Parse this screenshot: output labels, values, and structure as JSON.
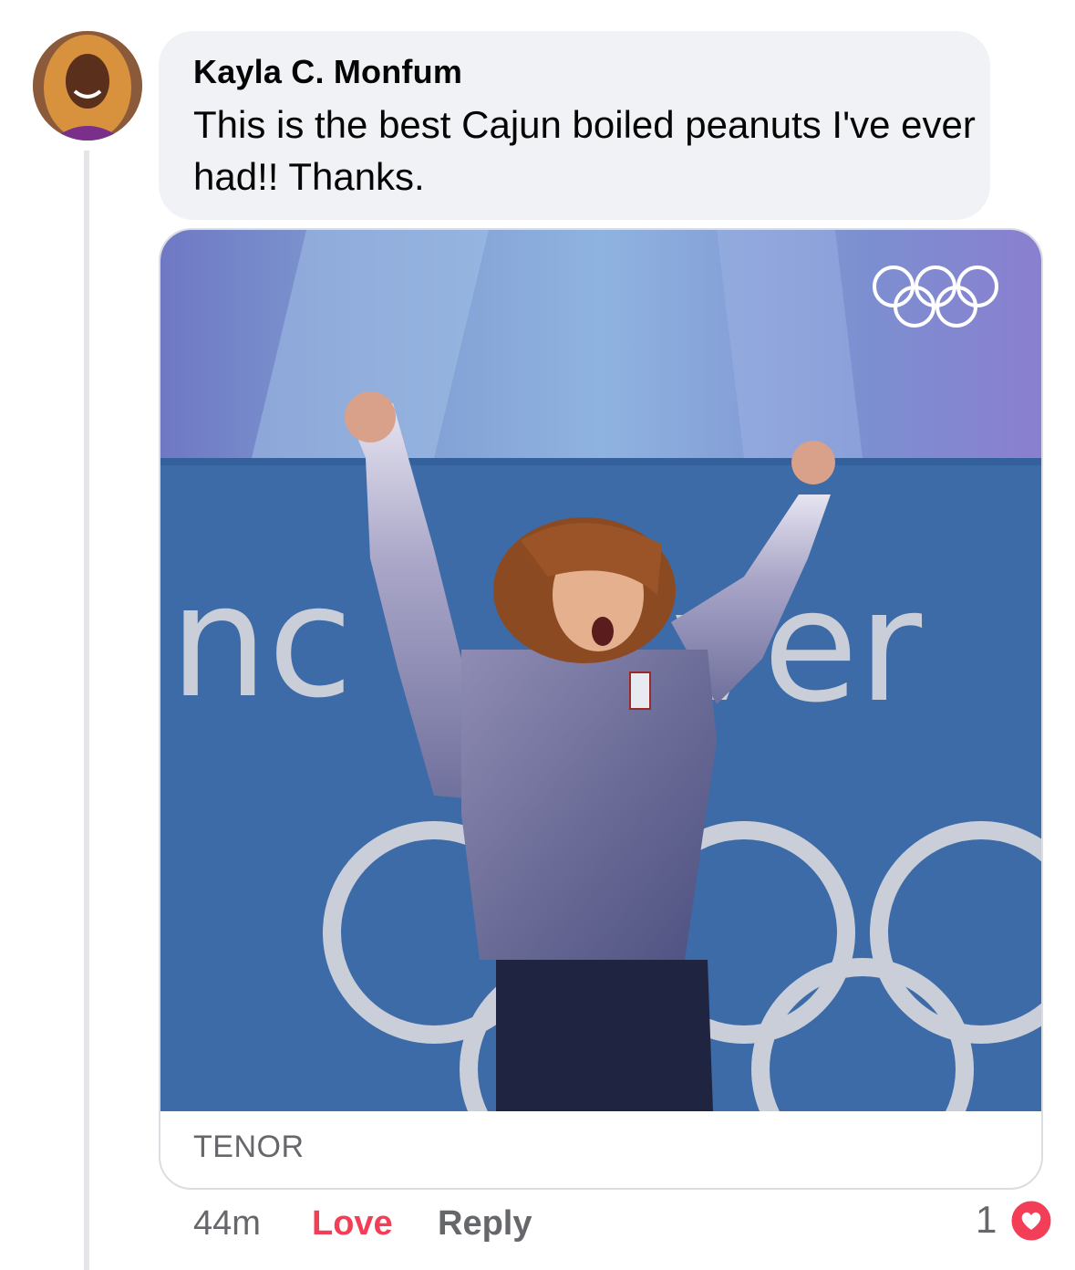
{
  "comment": {
    "author": "Kayla C. Monfum",
    "text": "This is the best Cajun boiled peanuts I've ever had!! Thanks.",
    "avatar_icon": "avatar-photo"
  },
  "attachment": {
    "sign_text_left": "nc",
    "sign_text_right": "ver",
    "source": "TENOR"
  },
  "actions": {
    "time": "44m",
    "love_label": "Love",
    "reply_label": "Reply",
    "reaction_count": "1",
    "reaction_icon": "love-reaction-icon"
  },
  "colors": {
    "bubble_bg": "#f0f2f5",
    "love_red": "#f33e58",
    "meta_gray": "#65676b",
    "banner_blue": "#3a6aa5"
  }
}
